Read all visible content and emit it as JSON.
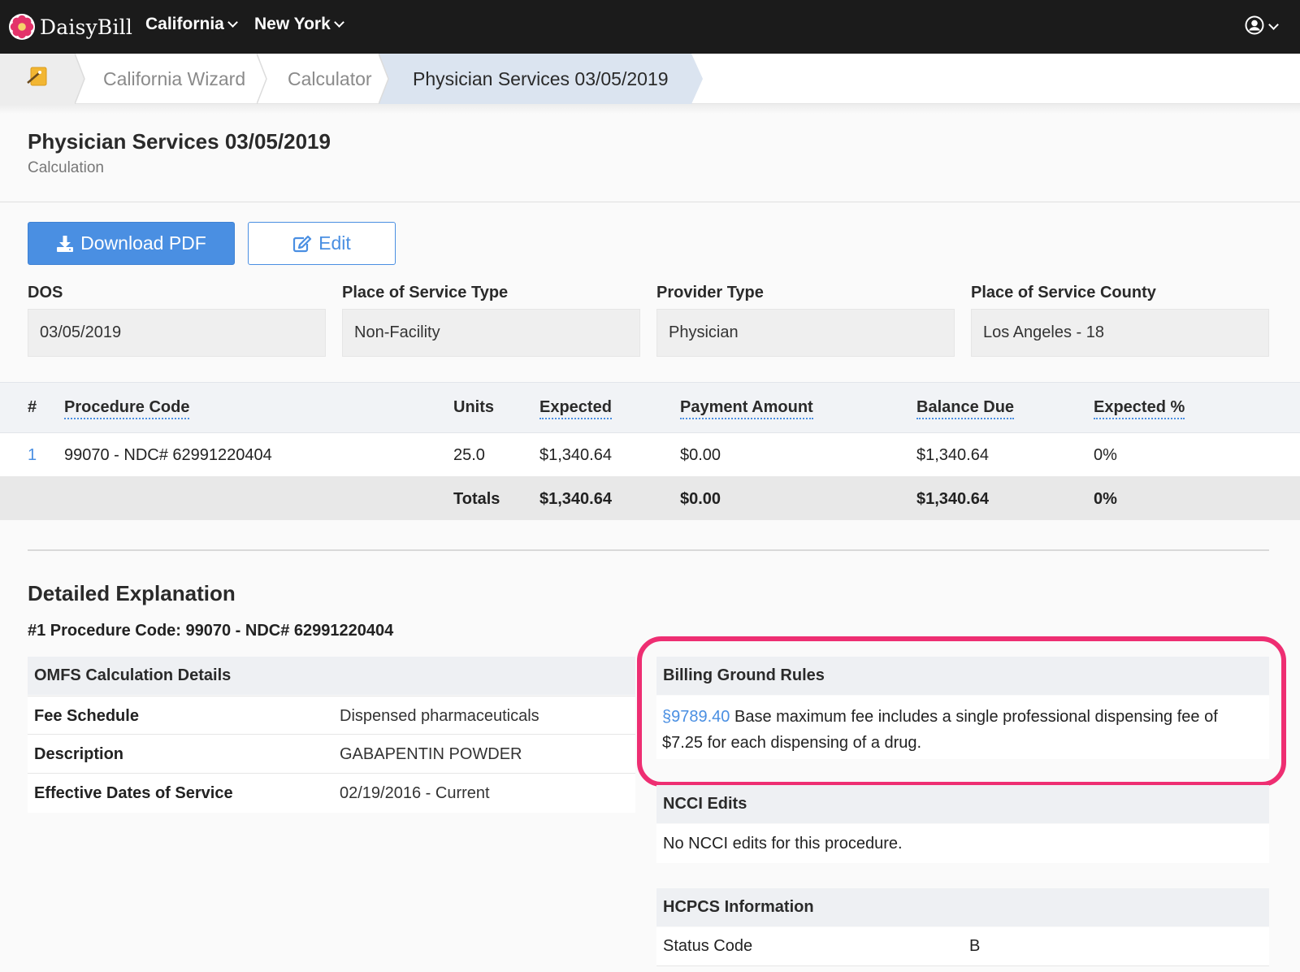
{
  "topnav": {
    "brand": "DaisyBill",
    "menus": [
      "California",
      "New York"
    ]
  },
  "breadcrumb": {
    "items": [
      "California Wizard",
      "Calculator",
      "Physician Services 03/05/2019"
    ]
  },
  "header": {
    "title": "Physician Services 03/05/2019",
    "subtitle": "Calculation"
  },
  "actions": {
    "download_label": "Download PDF",
    "edit_label": "Edit"
  },
  "fields": [
    {
      "label": "DOS",
      "value": "03/05/2019"
    },
    {
      "label": "Place of Service Type",
      "value": "Non-Facility"
    },
    {
      "label": "Provider Type",
      "value": "Physician"
    },
    {
      "label": "Place of Service County",
      "value": "Los Angeles - 18"
    }
  ],
  "table": {
    "columns": [
      "#",
      "Procedure Code",
      "Units",
      "Expected",
      "Payment Amount",
      "Balance Due",
      "Expected %"
    ],
    "rows": [
      {
        "num": "1",
        "code": "99070 - NDC# 62991220404",
        "units": "25.0",
        "expected": "$1,340.64",
        "payment": "$0.00",
        "balance": "$1,340.64",
        "pct": "0%"
      }
    ],
    "totals": {
      "label": "Totals",
      "expected": "$1,340.64",
      "payment": "$0.00",
      "balance": "$1,340.64",
      "pct": "0%"
    }
  },
  "explanation": {
    "title": "Detailed Explanation",
    "procedure": "#1 Procedure Code: 99070 - NDC# 62991220404",
    "omfs": {
      "heading": "OMFS Calculation Details",
      "rows": [
        {
          "key": "Fee Schedule",
          "value": "Dispensed pharmaceuticals"
        },
        {
          "key": "Description",
          "value": "GABAPENTIN POWDER"
        },
        {
          "key": "Effective Dates of Service",
          "value": "02/19/2016 - Current"
        }
      ]
    },
    "billing_rules": {
      "heading": "Billing Ground Rules",
      "link": "§9789.40",
      "text": " Base maximum fee includes a single professional dispensing fee of $7.25 for each dispensing of a drug."
    },
    "ncci": {
      "heading": "NCCI Edits",
      "text": "No NCCI edits for this procedure."
    },
    "hcpcs": {
      "heading": "HCPCS Information",
      "key": "Status Code",
      "value": "B"
    }
  },
  "colors": {
    "accent": "#4a8fe2",
    "highlight": "#ee2e72",
    "nav_bg": "#1b1b1b"
  }
}
